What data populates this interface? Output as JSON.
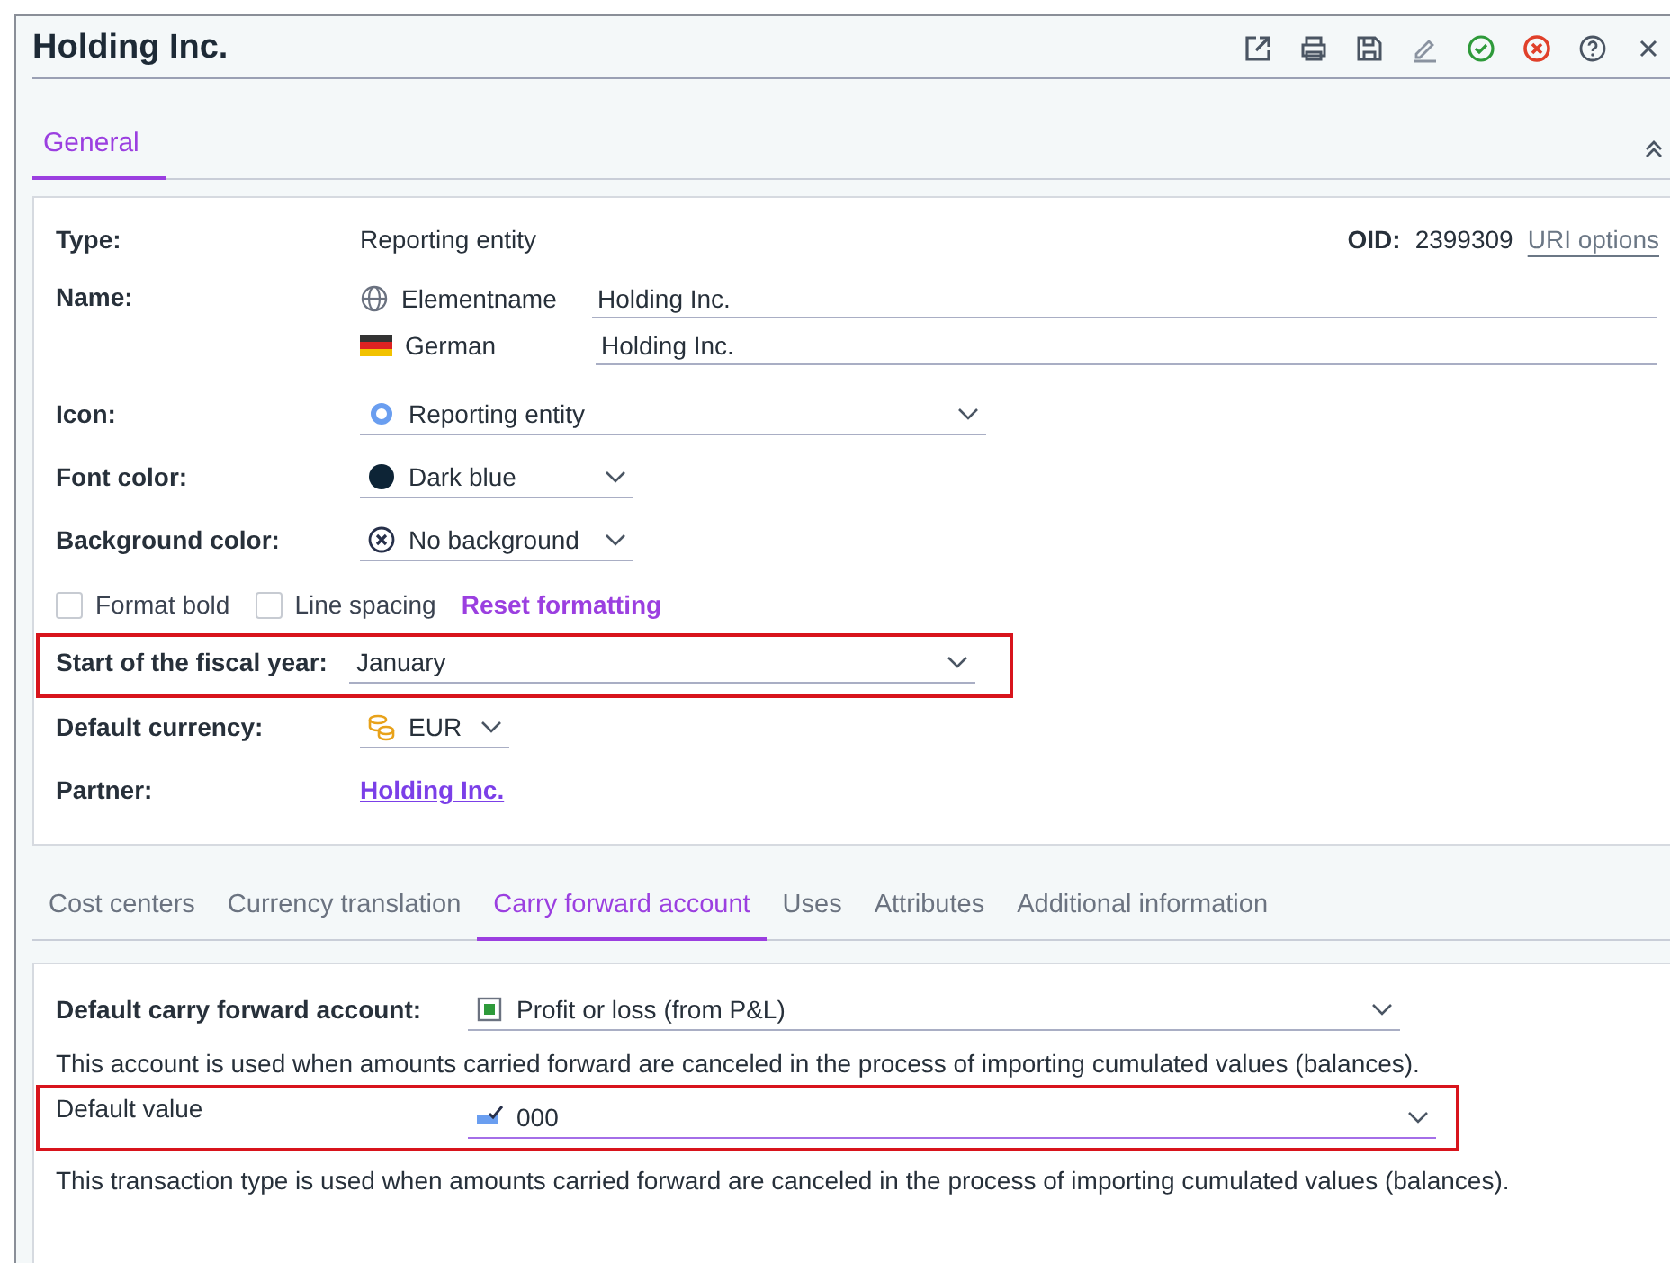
{
  "window": {
    "title": "Holding Inc."
  },
  "tabs": [
    {
      "label": "General",
      "selected": true
    }
  ],
  "general": {
    "rows": [
      {
        "kind": "text",
        "label": "Type:",
        "value": "Reporting entity",
        "highlighted": false,
        "oid": {
          "label": "OID:",
          "value": "2399309",
          "link": "URI options"
        }
      },
      {
        "kind": "names",
        "label": "Name:",
        "highlighted": false,
        "entries": [
          {
            "kind": "globe",
            "language": "Elementname",
            "value": "Holding Inc."
          },
          {
            "kind": "flag",
            "language": "German",
            "value": "Holding Inc."
          }
        ]
      },
      {
        "kind": "dropdown",
        "label": "Icon:",
        "value": "Reporting entity",
        "highlighted": false
      },
      {
        "kind": "dropdown",
        "label": "Font color:",
        "value": "Dark blue",
        "highlighted": false
      },
      {
        "kind": "dropdown",
        "label": "Background color:",
        "value": "No background",
        "highlighted": false
      },
      {
        "kind": "checkboxes",
        "highlighted": false,
        "items": [
          {
            "label": "Format bold",
            "checked": false
          },
          {
            "label": "Line spacing",
            "checked": false
          }
        ],
        "link": "Reset formatting"
      },
      {
        "kind": "dropdown",
        "label": "Start of the fiscal year:",
        "value": "January",
        "highlighted": true
      },
      {
        "kind": "dropdown",
        "label": "Default currency:",
        "value": "EUR",
        "highlighted": false
      },
      {
        "kind": "link",
        "label": "Partner:",
        "value": "Holding Inc.",
        "highlighted": false
      }
    ]
  },
  "subtabs": [
    {
      "label": "Cost centers",
      "selected": false
    },
    {
      "label": "Currency translation",
      "selected": false
    },
    {
      "label": "Carry forward account",
      "selected": true
    },
    {
      "label": "Uses",
      "selected": false
    },
    {
      "label": "Attributes",
      "selected": false
    },
    {
      "label": "Additional information",
      "selected": false
    }
  ],
  "carry_forward": {
    "rows": [
      {
        "kind": "dropdown",
        "label": "Default carry forward account:",
        "value": "Profit or loss (from P&L)",
        "bold_label": true,
        "focused": false,
        "highlighted": false
      },
      {
        "kind": "note",
        "text": "This account is used when amounts carried forward are canceled in the process of importing cumulated values (balances)."
      },
      {
        "kind": "dropdown",
        "label": "Default value",
        "value": "000",
        "bold_label": false,
        "focused": true,
        "highlighted": true
      },
      {
        "kind": "note",
        "text": "This transaction type is used when amounts carried forward are canceled in the process of importing cumulated values (balances)."
      }
    ]
  }
}
